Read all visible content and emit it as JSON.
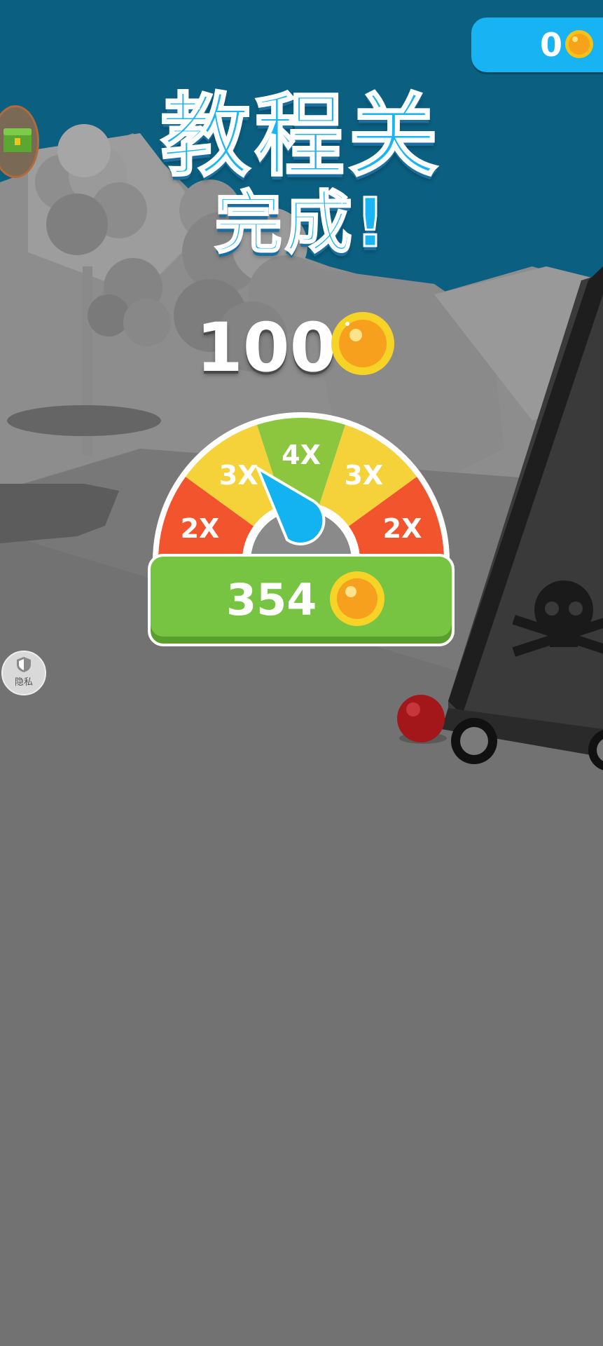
{
  "hud": {
    "coin_balance": "0"
  },
  "title": {
    "line1": "教程关",
    "line2": "完成!"
  },
  "reward": {
    "base_coins": "100"
  },
  "multiplier_gauge": {
    "segments": [
      "2X",
      "3X",
      "4X",
      "3X",
      "2X"
    ],
    "segment_colors": [
      "#f2542d",
      "#f6d23a",
      "#8cc63f",
      "#f6d23a",
      "#f2542d"
    ],
    "needle_color": "#13b2f0"
  },
  "claim": {
    "coins": "354"
  },
  "privacy": {
    "label": "隐私"
  },
  "icons": [
    "coin-icon",
    "treasure-chest-icon",
    "shield-icon",
    "skull-crossbones-icon"
  ]
}
